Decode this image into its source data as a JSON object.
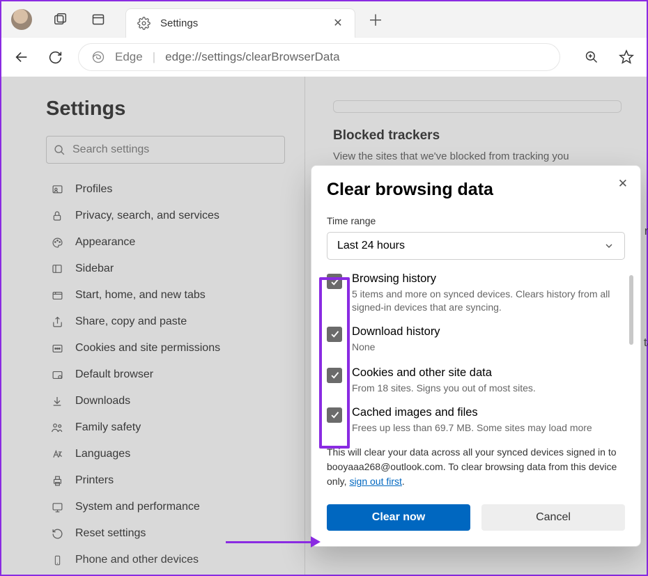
{
  "tab": {
    "title": "Settings"
  },
  "address": {
    "brand": "Edge",
    "url": "edge://settings/clearBrowserData"
  },
  "settings_heading": "Settings",
  "search": {
    "placeholder": "Search settings"
  },
  "nav": {
    "profiles": "Profiles",
    "privacy": "Privacy, search, and services",
    "appearance": "Appearance",
    "sidebar": "Sidebar",
    "start": "Start, home, and new tabs",
    "share": "Share, copy and paste",
    "cookies": "Cookies and site permissions",
    "default": "Default browser",
    "downloads": "Downloads",
    "family": "Family safety",
    "languages": "Languages",
    "printers": "Printers",
    "system": "System and performance",
    "reset": "Reset settings",
    "phone": "Phone and other devices"
  },
  "main": {
    "blocked_h": "Blocked trackers",
    "blocked_d": "View the sites that we've blocked from tracking you",
    "partial1": "nl",
    "partial2": "ta"
  },
  "dialog": {
    "title": "Clear browsing data",
    "timerange_label": "Time range",
    "timerange_value": "Last 24 hours",
    "opts": {
      "browsing": {
        "title": "Browsing history",
        "desc": "5 items and more on synced devices. Clears history from all signed-in devices that are syncing."
      },
      "download": {
        "title": "Download history",
        "desc": "None"
      },
      "cookies": {
        "title": "Cookies and other site data",
        "desc": "From 18 sites. Signs you out of most sites."
      },
      "cache": {
        "title": "Cached images and files",
        "desc": "Frees up less than 69.7 MB. Some sites may load more"
      }
    },
    "note_a": "This will clear your data across all your synced devices signed in to booyaaa268@outlook.com. To clear browsing data from this device only, ",
    "note_link": "sign out first",
    "note_b": ".",
    "clear": "Clear now",
    "cancel": "Cancel"
  }
}
